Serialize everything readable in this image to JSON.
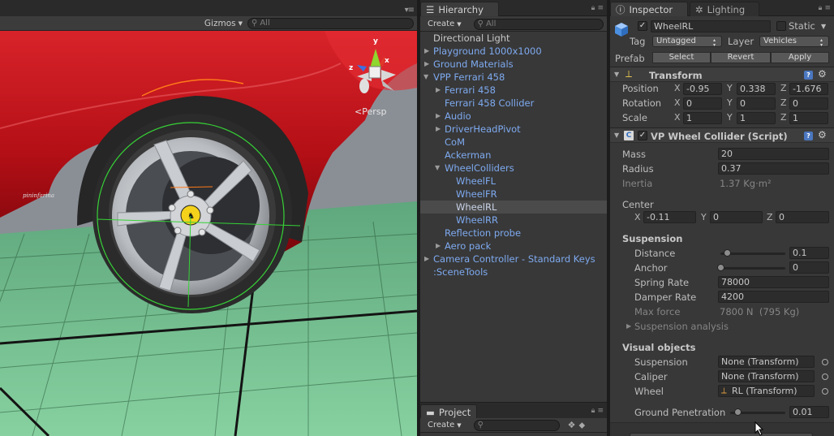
{
  "scene": {
    "gizmos_label": "Gizmos",
    "search_placeholder": "All",
    "persp_label": "Persp",
    "axis_y": "y",
    "axis_x": "x",
    "axis_z": "z",
    "car_badge_text": "pininfarina"
  },
  "hierarchy": {
    "tab_label": "Hierarchy",
    "create_label": "Create",
    "search_placeholder": "All",
    "items": [
      {
        "label": "Directional Light"
      },
      {
        "label": "Playground 1000x1000"
      },
      {
        "label": "Ground Materials"
      },
      {
        "label": "VPP Ferrari 458"
      },
      {
        "label": "Ferrari 458"
      },
      {
        "label": "Ferrari 458 Collider"
      },
      {
        "label": "Audio"
      },
      {
        "label": "DriverHeadPivot"
      },
      {
        "label": "CoM"
      },
      {
        "label": "Ackerman"
      },
      {
        "label": "WheelColliders"
      },
      {
        "label": "WheelFL"
      },
      {
        "label": "WheelFR"
      },
      {
        "label": "WheelRL"
      },
      {
        "label": "WheelRR"
      },
      {
        "label": "Reflection probe"
      },
      {
        "label": "Aero pack"
      },
      {
        "label": "Camera Controller - Standard Keys"
      },
      {
        "label": ":SceneTools"
      }
    ]
  },
  "project": {
    "tab_label": "Project",
    "create_label": "Create"
  },
  "inspector": {
    "tab_label": "Inspector",
    "lighting_tab_label": "Lighting",
    "object_name": "WheelRL",
    "static_label": "Static",
    "tag_label": "Tag",
    "tag_value": "Untagged",
    "layer_label": "Layer",
    "layer_value": "Vehicles",
    "prefab_label": "Prefab",
    "prefab_select": "Select",
    "prefab_revert": "Revert",
    "prefab_apply": "Apply",
    "transform": {
      "title": "Transform",
      "position_label": "Position",
      "rotation_label": "Rotation",
      "scale_label": "Scale",
      "position": {
        "x": "-0.95",
        "y": "0.338",
        "z": "-1.676"
      },
      "rotation": {
        "x": "0",
        "y": "0",
        "z": "0"
      },
      "scale": {
        "x": "1",
        "y": "1",
        "z": "1"
      }
    },
    "wheel_collider": {
      "title": "VP Wheel Collider (Script)",
      "mass_label": "Mass",
      "mass": "20",
      "radius_label": "Radius",
      "radius": "0.37",
      "inertia_label": "Inertia",
      "inertia": "1.37 Kg·m²",
      "center_label": "Center",
      "center": {
        "x": "-0.11",
        "y": "0",
        "z": "0"
      },
      "suspension_header": "Suspension",
      "distance_label": "Distance",
      "distance": "0.1",
      "distance_slider": 0.05,
      "anchor_label": "Anchor",
      "anchor": "0",
      "anchor_slider": 0.0,
      "spring_rate_label": "Spring Rate",
      "spring_rate": "78000",
      "damper_rate_label": "Damper Rate",
      "damper_rate": "4200",
      "max_force_label": "Max force",
      "max_force": "7800 N  (795 Kg)",
      "suspension_analysis_label": "Suspension analysis",
      "visual_header": "Visual objects",
      "v_suspension_label": "Suspension",
      "v_suspension": "None (Transform)",
      "v_caliper_label": "Caliper",
      "v_caliper": "None (Transform)",
      "v_wheel_label": "Wheel",
      "v_wheel": "RL (Transform)",
      "ground_penetration_label": "Ground Penetration",
      "ground_penetration": "0.01",
      "ground_penetration_slider": 0.1
    }
  },
  "axes": {
    "x": "X",
    "y": "Y",
    "z": "Z"
  },
  "colors": {
    "panel_bg": "#383838",
    "link_text": "#7eaaf0",
    "car_red": "#c0141a",
    "grid_green": "#6fbf8e"
  }
}
